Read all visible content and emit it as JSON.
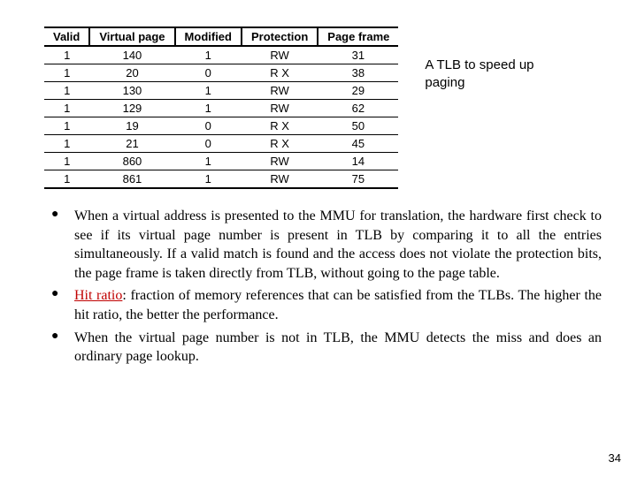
{
  "table": {
    "headers": [
      "Valid",
      "Virtual page",
      "Modified",
      "Protection",
      "Page frame"
    ],
    "rows": [
      [
        "1",
        "140",
        "1",
        "RW",
        "31"
      ],
      [
        "1",
        "20",
        "0",
        "R X",
        "38"
      ],
      [
        "1",
        "130",
        "1",
        "RW",
        "29"
      ],
      [
        "1",
        "129",
        "1",
        "RW",
        "62"
      ],
      [
        "1",
        "19",
        "0",
        "R X",
        "50"
      ],
      [
        "1",
        "21",
        "0",
        "R X",
        "45"
      ],
      [
        "1",
        "860",
        "1",
        "RW",
        "14"
      ],
      [
        "1",
        "861",
        "1",
        "RW",
        "75"
      ]
    ]
  },
  "caption": "A TLB to speed up paging",
  "bullets": {
    "b0": "When a virtual address is presented to the MMU for translation, the hardware first check to see if its virtual page number is present in TLB by comparing it to all the entries simultaneously. If a valid match is found and the access does not violate the protection bits, the page frame is taken directly from TLB, without going to the page table.",
    "b1_prefix": "Hit ratio",
    "b1_rest": ": fraction of memory references that can be satisfied from the TLBs. The higher the hit ratio, the better the performance.",
    "b2": "When the virtual page number is not in TLB, the MMU detects the miss and does an ordinary page lookup."
  },
  "page_number": "34",
  "chart_data": {
    "type": "table",
    "title": "A TLB to speed up paging",
    "columns": [
      "Valid",
      "Virtual page",
      "Modified",
      "Protection",
      "Page frame"
    ],
    "rows": [
      [
        1,
        140,
        1,
        "RW",
        31
      ],
      [
        1,
        20,
        0,
        "R X",
        38
      ],
      [
        1,
        130,
        1,
        "RW",
        29
      ],
      [
        1,
        129,
        1,
        "RW",
        62
      ],
      [
        1,
        19,
        0,
        "R X",
        50
      ],
      [
        1,
        21,
        0,
        "R X",
        45
      ],
      [
        1,
        860,
        1,
        "RW",
        14
      ],
      [
        1,
        861,
        1,
        "RW",
        75
      ]
    ]
  }
}
